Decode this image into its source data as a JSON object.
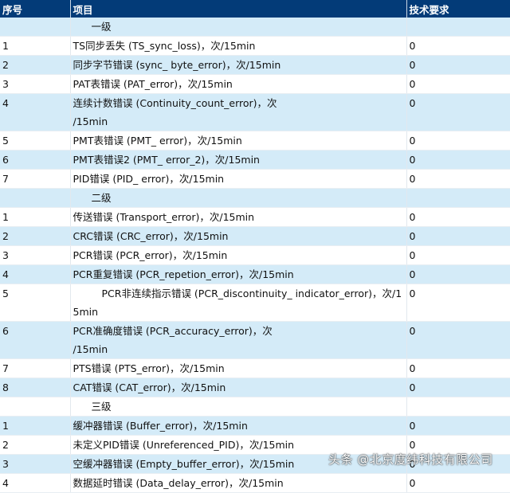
{
  "header": {
    "col_no": "序号",
    "col_item": "项目",
    "col_req": "技术要求"
  },
  "levels": [
    {
      "title": "一级",
      "rows": [
        {
          "no": "1",
          "item": [
            "TS同步丢失 (TS_sync_loss)，次/15min"
          ],
          "req": "0"
        },
        {
          "no": "2",
          "item": [
            "同步字节错误 (sync_ byte_error)，次/15min"
          ],
          "req": "0"
        },
        {
          "no": "3",
          "item": [
            "PAT表错误 (PAT_error)，次/15min"
          ],
          "req": "0"
        },
        {
          "no": "4",
          "item": [
            "连续计数错误 (Continuity_count_error)，次",
            "/15min"
          ],
          "req": "0"
        },
        {
          "no": "5",
          "item": [
            "PMT表错误 (PMT_ error)，次/15min"
          ],
          "req": "0"
        },
        {
          "no": "6",
          "item": [
            "PMT表错误2 (PMT_ error_2)，次/15min"
          ],
          "req": "0"
        },
        {
          "no": "7",
          "item": [
            "PID错误 (PID_ error)，次/15min"
          ],
          "req": "0"
        }
      ]
    },
    {
      "title": "二级",
      "rows": [
        {
          "no": "1",
          "item": [
            "传送错误 (Transport_error)，次/15min"
          ],
          "req": "0"
        },
        {
          "no": "2",
          "item": [
            "CRC错误 (CRC_error)，次/15min"
          ],
          "req": "0"
        },
        {
          "no": "3",
          "item": [
            "PCR错误 (PCR_error)，次/15min"
          ],
          "req": "0"
        },
        {
          "no": "4",
          "item": [
            "PCR重复错误 (PCR_repetion_error)，次/15min"
          ],
          "req": "0"
        },
        {
          "no": "5",
          "item": [
            "PCR非连续指示错误 (PCR_discontinuity_ indicator_error)，次/1",
            "5min"
          ],
          "req": "0",
          "indent": true
        },
        {
          "no": "6",
          "item": [
            "PCR准确度错误 (PCR_accuracy_error)，次",
            "/15min"
          ],
          "req": "0"
        },
        {
          "no": "7",
          "item": [
            "PTS错误 (PTS_error)，次/15min"
          ],
          "req": "0"
        },
        {
          "no": "8",
          "item": [
            "CAT错误 (CAT_error)，次/15min"
          ],
          "req": "0"
        }
      ]
    },
    {
      "title": "三级",
      "rows": [
        {
          "no": "1",
          "item": [
            "缓冲器错误 (Buffer_error)，次/15min"
          ],
          "req": "0"
        },
        {
          "no": "2",
          "item": [
            "未定义PID错误 (Unreferenced_PID)，次/15min"
          ],
          "req": "0"
        },
        {
          "no": "3",
          "item": [
            "空缓冲器错误 (Empty_buffer_error)，次/15min"
          ],
          "req": "0"
        },
        {
          "no": "4",
          "item": [
            "数据延时错误 (Data_delay_error)，次/15min"
          ],
          "req": "0"
        }
      ]
    }
  ],
  "watermark": "头条 @北京度纬科技有限公司",
  "colors": {
    "header_bg": "#033b78",
    "row_alt": "#d4ebf8"
  }
}
